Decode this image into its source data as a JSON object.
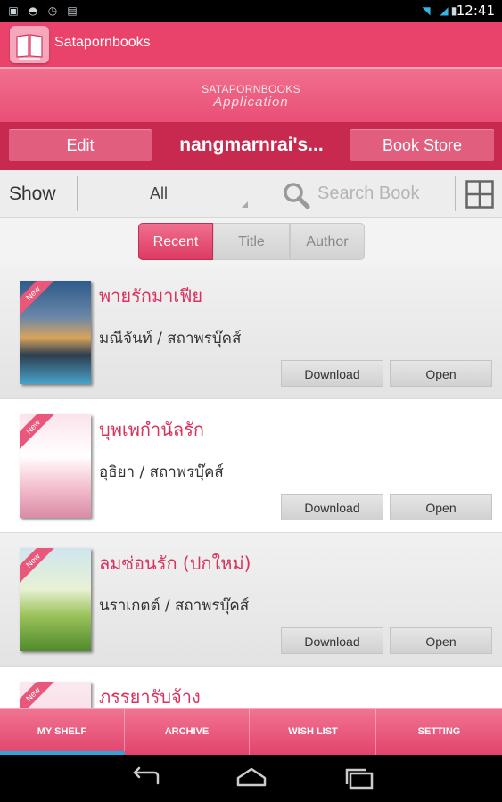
{
  "status_bar": {
    "time": "12:41"
  },
  "action_bar": {
    "app_title": "Satapornbooks"
  },
  "banner": {
    "brand": "SATAPORNBOOKS",
    "subtitle": "Application"
  },
  "toolbar": {
    "edit_label": "Edit",
    "shelf_owner": "nangmarnrai's...",
    "store_label": "Book Store"
  },
  "filter": {
    "show_label": "Show",
    "show_value": "All",
    "search_placeholder": "Search Book"
  },
  "sort_tabs": [
    {
      "label": "Recent",
      "selected": true
    },
    {
      "label": "Title",
      "selected": false
    },
    {
      "label": "Author",
      "selected": false
    }
  ],
  "books": [
    {
      "title": "พายรักมาเฟีย",
      "author": "มณีจันท์ / สถาพรบุ๊คส์",
      "badge": "New",
      "download_label": "Download",
      "open_label": "Open"
    },
    {
      "title": "บุพเพกำนัลรัก",
      "author": "อุธิยา / สถาพรบุ๊คส์",
      "badge": "New",
      "download_label": "Download",
      "open_label": "Open"
    },
    {
      "title": "ลมซ่อนรัก (ปกใหม่)",
      "author": "นราเกตต์ / สถาพรบุ๊คส์",
      "badge": "New",
      "download_label": "Download",
      "open_label": "Open"
    },
    {
      "title": "ภรรยารับจ้าง",
      "badge": "New"
    }
  ],
  "bottom_tabs": [
    {
      "label": "MY SHELF",
      "selected": true
    },
    {
      "label": "ARCHIVE"
    },
    {
      "label": "WISH LIST"
    },
    {
      "label": "SETTING"
    }
  ],
  "colors": {
    "accent": "#e9436b",
    "accent_dark": "#c72a4e",
    "title_pink": "#d9335c",
    "tab_indicator": "#2ea4d9"
  }
}
